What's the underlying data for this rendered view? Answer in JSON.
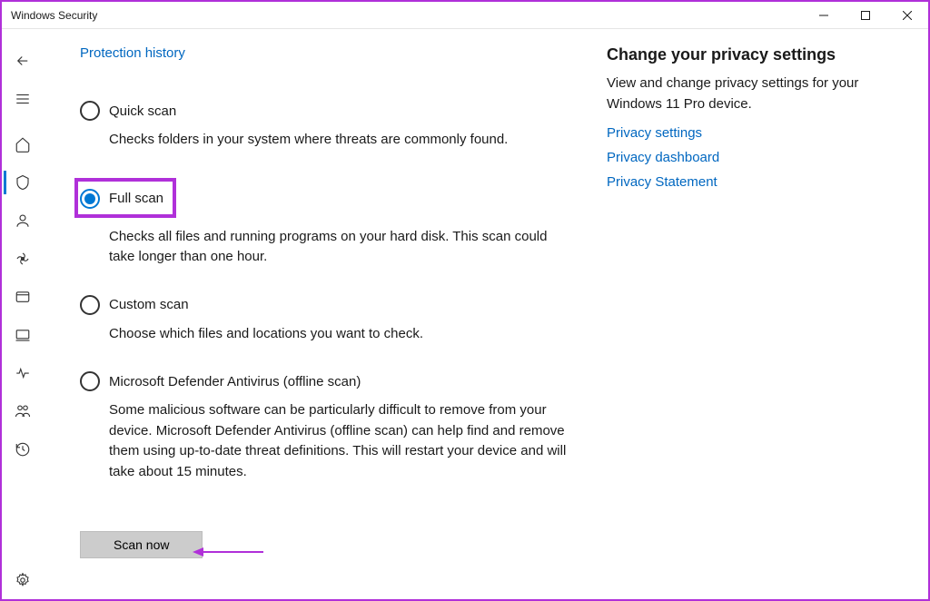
{
  "titlebar": {
    "title": "Windows Security"
  },
  "main": {
    "protection_history": "Protection history",
    "options": {
      "quick": {
        "label": "Quick scan",
        "desc": "Checks folders in your system where threats are commonly found."
      },
      "full": {
        "label": "Full scan",
        "desc": "Checks all files and running programs on your hard disk. This scan could take longer than one hour."
      },
      "custom": {
        "label": "Custom scan",
        "desc": "Choose which files and locations you want to check."
      },
      "offline": {
        "label": "Microsoft Defender Antivirus (offline scan)",
        "desc": "Some malicious software can be particularly difficult to remove from your device. Microsoft Defender Antivirus (offline scan) can help find and remove them using up-to-date threat definitions. This will restart your device and will take about 15 minutes."
      }
    },
    "scan_now": "Scan now"
  },
  "right": {
    "heading": "Change your privacy settings",
    "desc": "View and change privacy settings for your Windows 11 Pro device.",
    "links": {
      "settings": "Privacy settings",
      "dashboard": "Privacy dashboard",
      "statement": "Privacy Statement"
    }
  }
}
